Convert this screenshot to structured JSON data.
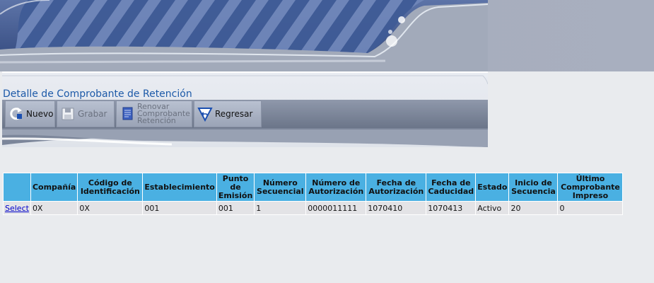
{
  "page": {
    "title": "Detalle de Comprobante de Retención"
  },
  "toolbar": {
    "nuevo": "Nuevo",
    "grabar": "Grabar",
    "renovar": "Renovar\nComprobante\nRetención",
    "regresar": "Regresar"
  },
  "grid": {
    "headers": [
      "",
      "Compañía",
      "Código de Identificación",
      "Establecimiento",
      "Punto de Emisión",
      "Número Secuencial",
      "Número de Autorización",
      "Fecha de Autorización",
      "Fecha de Caducidad",
      "Estado",
      "Inicio de Secuencia",
      "Último Comprobante Impreso"
    ],
    "rows": [
      [
        "Select",
        "0X",
        "0X",
        "001",
        "001",
        "1",
        "0000011111",
        "1070410",
        "1070413",
        "Activo",
        "20",
        "0"
      ]
    ]
  },
  "colors": {
    "header_bg": "#4ab0e2",
    "row_bg": "#e3e3e6",
    "title": "#1d5aa8",
    "link": "#0000cc"
  },
  "icons": [
    "refresh-icon",
    "save-icon",
    "document-icon",
    "back-arrow-icon"
  ]
}
